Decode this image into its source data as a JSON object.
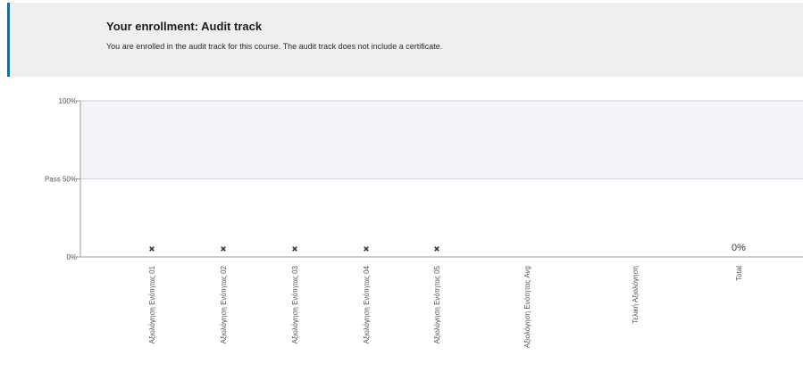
{
  "enrollment": {
    "title": "Your enrollment: Audit track",
    "message": "You are enrolled in the audit track for this course. The audit track does not include a certificate."
  },
  "chart_data": {
    "type": "scatter",
    "title": "",
    "xlabel": "",
    "ylabel": "",
    "ylim": [
      0,
      100
    ],
    "y_ticks": [
      "0%",
      "Pass 50%",
      "100%"
    ],
    "categories": [
      "Αξιολόγηση Ενότητας 01",
      "Αξιολόγηση Ενότητας 02",
      "Αξιολόγηση Ενότητας 03",
      "Αξιολόγηση Ενότητας 04",
      "Αξιολόγηση Ενότητας 05",
      "Αξιολόγηση Ενότητας Avg",
      "Τελική Αξιολόγηση",
      "Total"
    ],
    "values": [
      0,
      0,
      0,
      0,
      0,
      null,
      null,
      0
    ],
    "markers": [
      "x",
      "x",
      "x",
      "x",
      "x",
      "",
      "",
      ""
    ],
    "data_labels": [
      "",
      "",
      "",
      "",
      "",
      "",
      "",
      "0%"
    ],
    "pass_threshold": 50,
    "colors": {
      "passed_region": "#f4f5f9",
      "axis": "#9a9a9a",
      "marker": "#333333"
    }
  }
}
